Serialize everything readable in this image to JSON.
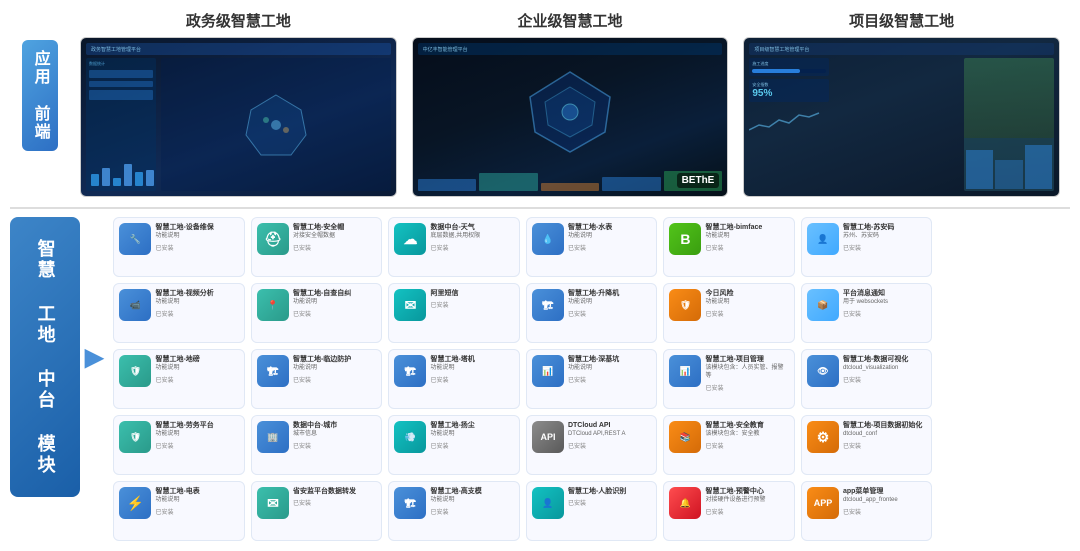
{
  "header": {
    "gov_title": "政务级智慧工地",
    "enterprise_title": "企业级智慧工地",
    "project_title": "项目级智慧工地"
  },
  "left_labels": {
    "top": "应用\n前端"
  },
  "bottom_label": "智慧\n工地\n中台\n模块",
  "arrow": "▶",
  "modules": [
    {
      "title": "智慧工地-设备维保",
      "desc": "功能说明",
      "status": "已安装",
      "icon": "🔧",
      "color": "icon-blue"
    },
    {
      "title": "智慧工地-安全帽",
      "desc": "对接安全帽数据",
      "status": "已安装",
      "icon": "⛑",
      "color": "icon-teal"
    },
    {
      "title": "数据中台-天气",
      "desc": "底层数据,共用权限",
      "status": "已安装",
      "icon": "☁",
      "color": "icon-cyan"
    },
    {
      "title": "智慧工地-水表",
      "desc": "功能说明",
      "status": "已安装",
      "icon": "💧",
      "color": "icon-blue"
    },
    {
      "title": "智慧工地-bimface",
      "desc": "功能说明",
      "status": "已安装",
      "icon": "B",
      "color": "icon-green"
    },
    {
      "title": "智慧工地-苏安码",
      "desc": "苏州、苏安码",
      "status": "已安装",
      "icon": "👤",
      "color": "icon-lightblue"
    },
    {
      "title": "",
      "desc": "",
      "status": "",
      "icon": "",
      "color": ""
    },
    {
      "title": "智慧工地-视频分析",
      "desc": "功能说明",
      "status": "已安装",
      "icon": "📹",
      "color": "icon-blue"
    },
    {
      "title": "智慧工地-自查自纠",
      "desc": "功能说明",
      "status": "已安装",
      "icon": "📍",
      "color": "icon-teal"
    },
    {
      "title": "阿里短信",
      "desc": "",
      "status": "已安装",
      "icon": "✉",
      "color": "icon-cyan"
    },
    {
      "title": "智慧工地-升降机",
      "desc": "功能说明",
      "status": "已安装",
      "icon": "🏗",
      "color": "icon-blue"
    },
    {
      "title": "今日风险",
      "desc": "功能说明",
      "status": "已安装",
      "icon": "🛡",
      "color": "icon-orange"
    },
    {
      "title": "平台消息通知",
      "desc": "用于 websockets",
      "status": "已安装",
      "icon": "📦",
      "color": "icon-lightblue"
    },
    {
      "title": "",
      "desc": "",
      "status": "",
      "icon": "",
      "color": ""
    },
    {
      "title": "智慧工地-地磅",
      "desc": "功能说明",
      "status": "已安装",
      "icon": "🛡",
      "color": "icon-teal"
    },
    {
      "title": "智慧工地-临边防护",
      "desc": "功能说明",
      "status": "已安装",
      "icon": "🏗",
      "color": "icon-blue"
    },
    {
      "title": "智慧工地-塔机",
      "desc": "功能说明",
      "status": "已安装",
      "icon": "🏗",
      "color": "icon-blue"
    },
    {
      "title": "智慧工地-深基坑",
      "desc": "功能说明",
      "status": "已安装",
      "icon": "📊",
      "color": "icon-blue"
    },
    {
      "title": "智慧工地-项目管理",
      "desc": "该模块包含：人员实管、报警等",
      "status": "已安装",
      "icon": "📊",
      "color": "icon-blue"
    },
    {
      "title": "智慧工地-数据可视化",
      "desc": "dtcloud_visualization",
      "status": "已安装",
      "icon": "👁",
      "color": "icon-blue"
    },
    {
      "title": "",
      "desc": "",
      "status": "",
      "icon": "",
      "color": ""
    },
    {
      "title": "智慧工地-劳务平台",
      "desc": "功能说明",
      "status": "已安装",
      "icon": "🛡",
      "color": "icon-teal"
    },
    {
      "title": "数据中台-城市",
      "desc": "城市信息",
      "status": "已安装",
      "icon": "🏢",
      "color": "icon-blue"
    },
    {
      "title": "智慧工地-扬尘",
      "desc": "功能说明",
      "status": "已安装",
      "icon": "💨",
      "color": "icon-cyan"
    },
    {
      "title": "DTCloud API",
      "desc": "DTCloud API,REST A",
      "status": "已安装",
      "icon": "API",
      "color": "icon-gray"
    },
    {
      "title": "智慧工地-安全教育",
      "desc": "该模块包含：安全教",
      "status": "已安装",
      "icon": "📚",
      "color": "icon-orange"
    },
    {
      "title": "智慧工地-项目数据初始化",
      "desc": "dtcloud_conf",
      "status": "已安装",
      "icon": "⚙",
      "color": "icon-orange"
    },
    {
      "title": "",
      "desc": "",
      "status": "",
      "icon": "",
      "color": ""
    },
    {
      "title": "智慧工地-电表",
      "desc": "功能说明",
      "status": "已安装",
      "icon": "⚡",
      "color": "icon-blue"
    },
    {
      "title": "省安监平台数据转发",
      "desc": "",
      "status": "已安装",
      "icon": "✉",
      "color": "icon-teal"
    },
    {
      "title": "智慧工地-高支模",
      "desc": "功能说明",
      "status": "已安装",
      "icon": "🏗",
      "color": "icon-blue"
    },
    {
      "title": "智慧工地-人脸识别",
      "desc": "",
      "status": "已安装",
      "icon": "👤",
      "color": "icon-cyan"
    },
    {
      "title": "智慧工地-预警中心",
      "desc": "对接硬件设备进行预警",
      "status": "已安装",
      "icon": "🔔",
      "color": "icon-red"
    },
    {
      "title": "app菜单管理",
      "desc": "dtcloud_app_frontee",
      "status": "已安装",
      "icon": "APP",
      "color": "icon-orange"
    },
    {
      "title": "",
      "desc": "",
      "status": "",
      "icon": "",
      "color": ""
    }
  ]
}
